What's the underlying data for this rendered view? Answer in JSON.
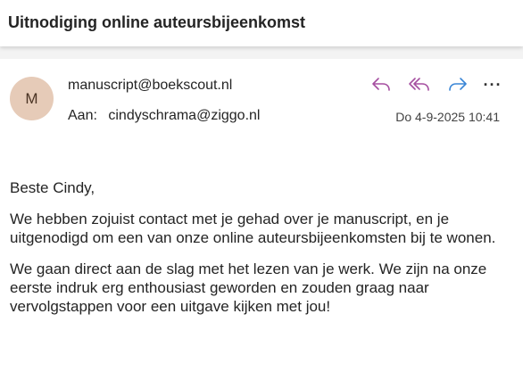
{
  "subject": "Uitnodiging online auteursbijeenkomst",
  "sender": {
    "avatar_initial": "M",
    "avatar_color": "#e6cbb8",
    "email": "manuscript@boekscout.nl"
  },
  "recipient": {
    "label": "Aan:",
    "email": "cindyschrama@ziggo.nl"
  },
  "date": "Do 4-9-2025 10:41",
  "actions": {
    "reply_icon": "reply-icon",
    "reply_all_icon": "reply-all-icon",
    "forward_icon": "forward-icon",
    "more_label": "···",
    "reply_color": "#a54fa0",
    "forward_color": "#3a86d6"
  },
  "body": {
    "greeting": "Beste Cindy,",
    "paragraph1": "We hebben zojuist contact met je gehad over je manuscript, en je uitgenodigd om een van onze online auteursbijeenkomsten bij te wonen.",
    "paragraph2": "We gaan direct aan de slag met het lezen van je werk. We zijn na onze eerste indruk erg enthousiast geworden en zouden graag naar vervolgstappen voor een uitgave kijken met jou!"
  }
}
